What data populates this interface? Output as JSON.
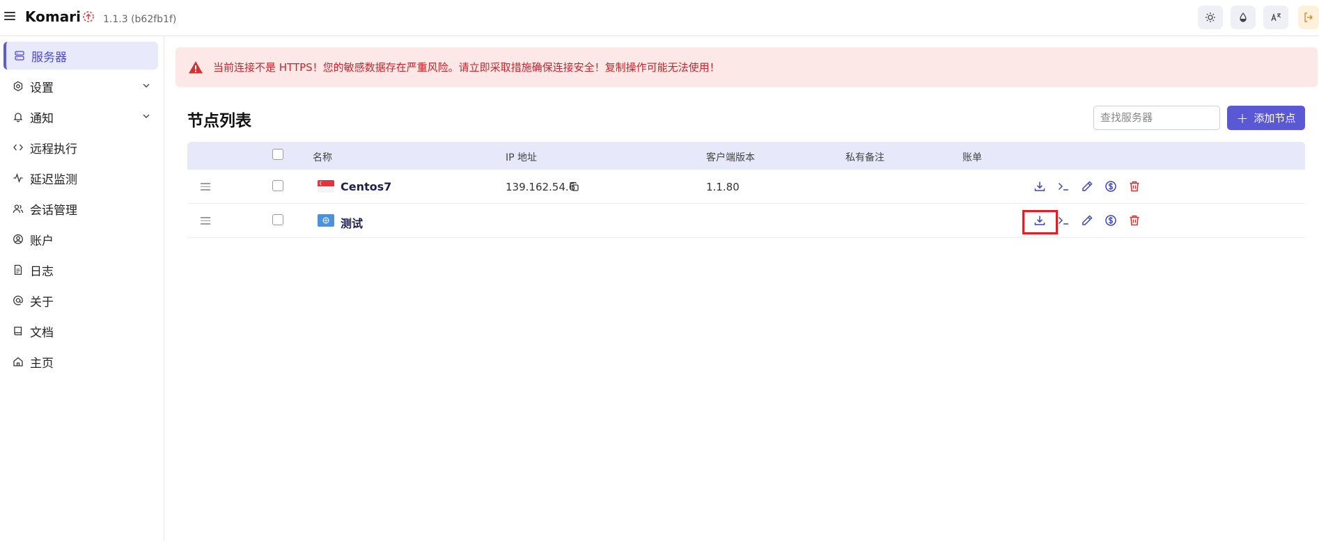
{
  "header": {
    "brand": "Komari",
    "version": "1.1.3 (b62fb1f)",
    "icons": [
      "menu-icon",
      "update-icon",
      "sun-icon",
      "theme-drop-icon",
      "translate-icon",
      "logout-icon"
    ]
  },
  "sidebar": {
    "items": [
      {
        "label": "服务器",
        "icon": "server-icon",
        "active": true
      },
      {
        "label": "设置",
        "icon": "settings-icon",
        "expandable": true
      },
      {
        "label": "通知",
        "icon": "bell-icon",
        "expandable": true
      },
      {
        "label": "远程执行",
        "icon": "code-icon"
      },
      {
        "label": "延迟监测",
        "icon": "activity-icon"
      },
      {
        "label": "会话管理",
        "icon": "users-icon"
      },
      {
        "label": "账户",
        "icon": "user-circle-icon"
      },
      {
        "label": "日志",
        "icon": "file-icon"
      },
      {
        "label": "关于",
        "icon": "at-icon"
      },
      {
        "label": "文档",
        "icon": "book-icon"
      },
      {
        "label": "主页",
        "icon": "home-icon"
      }
    ]
  },
  "alert": {
    "text": "当前连接不是 HTTPS！您的敏感数据存在严重风险。请立即采取措施确保连接安全！复制操作可能无法使用！",
    "color": "#c0282d"
  },
  "main": {
    "title": "节点列表",
    "search_placeholder": "查找服务器",
    "add_label": "添加节点"
  },
  "table": {
    "columns": [
      "名称",
      "IP 地址",
      "客户端版本",
      "私有备注",
      "账单"
    ],
    "rows": [
      {
        "flag": "singapore-flag",
        "name": "Centos7",
        "ip": "139.162.54.6",
        "version": "1.1.80",
        "note": "",
        "billing": ""
      },
      {
        "flag": "un-flag",
        "name": "测试",
        "ip": "",
        "version": "",
        "note": "",
        "billing": ""
      }
    ],
    "actions": [
      "download-icon",
      "terminal-icon",
      "edit-icon",
      "billing-icon",
      "delete-icon"
    ]
  },
  "colors": {
    "accent": "#5b58d6",
    "header_bg": "#e8e8fb",
    "danger": "#d23232"
  }
}
